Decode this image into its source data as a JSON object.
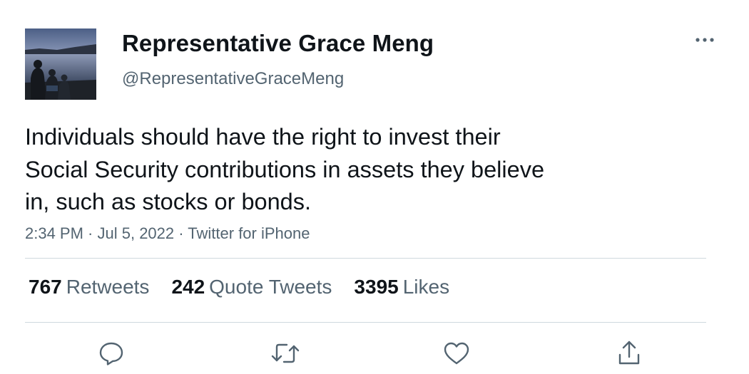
{
  "author": {
    "name": "Representative Grace Meng",
    "handle": "@RepresentativeGraceMeng"
  },
  "tweet": {
    "text_lines": [
      "Individuals should have the right to invest their",
      "Social Security contributions in assets they believe",
      "in, such as stocks or bonds."
    ],
    "time": "2:34 PM",
    "date": "Jul 5, 2022",
    "source": "Twitter for iPhone",
    "separator": " · "
  },
  "stats": {
    "retweets_count": "767",
    "retweets_label": "Retweets",
    "quotes_count": "242",
    "quotes_label": "Quote Tweets",
    "likes_count": "3395",
    "likes_label": "Likes"
  },
  "icons": {
    "more": "more-horizontal-icon",
    "reply": "reply-icon",
    "retweet": "retweet-icon",
    "like": "heart-icon",
    "share": "share-icon"
  },
  "colors": {
    "text_primary": "#0f1419",
    "text_secondary": "#536471",
    "divider": "#cfd9de"
  }
}
